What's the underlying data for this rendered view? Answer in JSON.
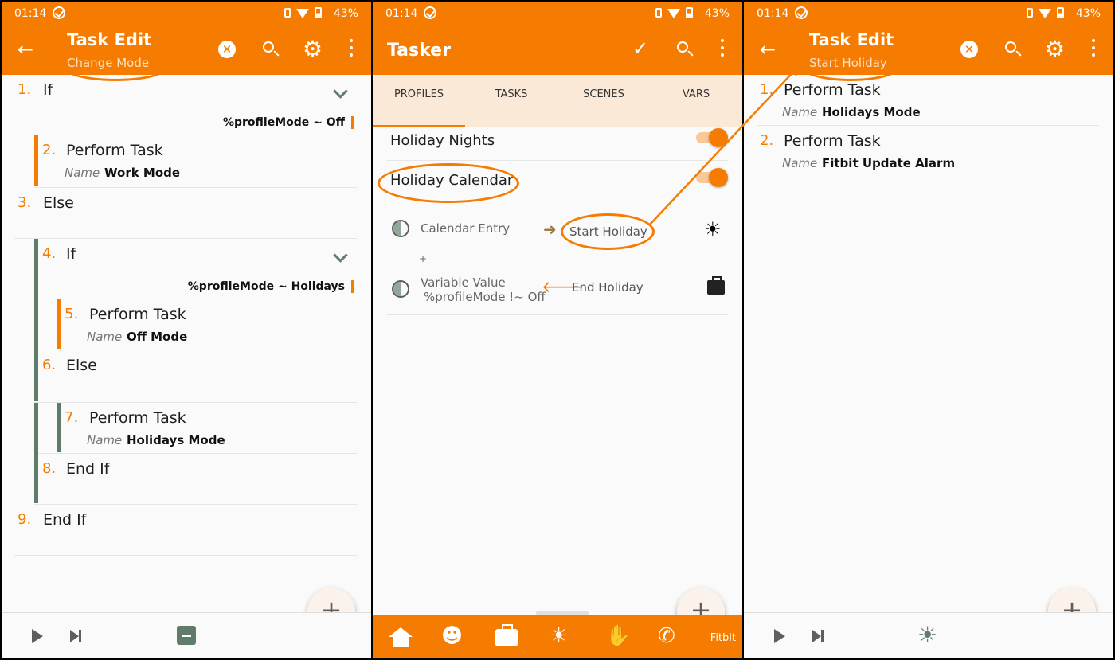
{
  "status": {
    "time": "01:14",
    "battery": "43%"
  },
  "screen1": {
    "title": "Task Edit",
    "subtitle": "Change Mode",
    "actions": [
      {
        "number": "1.",
        "label": "If",
        "condition": "%profileMode ~ Off"
      },
      {
        "number": "2.",
        "label": "Perform Task",
        "arg_name": "Name",
        "arg_value": "Work Mode"
      },
      {
        "number": "3.",
        "label": "Else"
      },
      {
        "number": "4.",
        "label": "If",
        "condition": "%profileMode ~ Holidays"
      },
      {
        "number": "5.",
        "label": "Perform Task",
        "arg_name": "Name",
        "arg_value": "Off Mode"
      },
      {
        "number": "6.",
        "label": "Else"
      },
      {
        "number": "7.",
        "label": "Perform Task",
        "arg_name": "Name",
        "arg_value": "Holidays Mode"
      },
      {
        "number": "8.",
        "label": "End If"
      },
      {
        "number": "9.",
        "label": "End If"
      }
    ],
    "fab": "+"
  },
  "screen2": {
    "title": "Tasker",
    "tabs": [
      "PROFILES",
      "TASKS",
      "SCENES",
      "VARS"
    ],
    "profiles": [
      {
        "name": "Holiday Nights",
        "enabled": true
      },
      {
        "name": "Holiday Calendar",
        "enabled": true
      }
    ],
    "contexts": {
      "calendar": "Calendar Entry",
      "plus": "+",
      "variable_line1": "Variable Value",
      "variable_line2": "%profileMode !~ Off",
      "enter_task": "Start Holiday",
      "exit_task": "End Holiday"
    },
    "nav_label": "Fitbit",
    "fab": "+"
  },
  "screen3": {
    "title": "Task Edit",
    "subtitle": "Start Holiday",
    "actions": [
      {
        "number": "1.",
        "label": "Perform Task",
        "arg_name": "Name",
        "arg_value": "Holidays Mode"
      },
      {
        "number": "2.",
        "label": "Perform Task",
        "arg_name": "Name",
        "arg_value": "Fitbit Update Alarm"
      }
    ],
    "fab": "+"
  },
  "colors": {
    "accent": "#f57c00",
    "tab_bg": "#fbe9d8",
    "indent_bar": "#5f7c6b"
  }
}
